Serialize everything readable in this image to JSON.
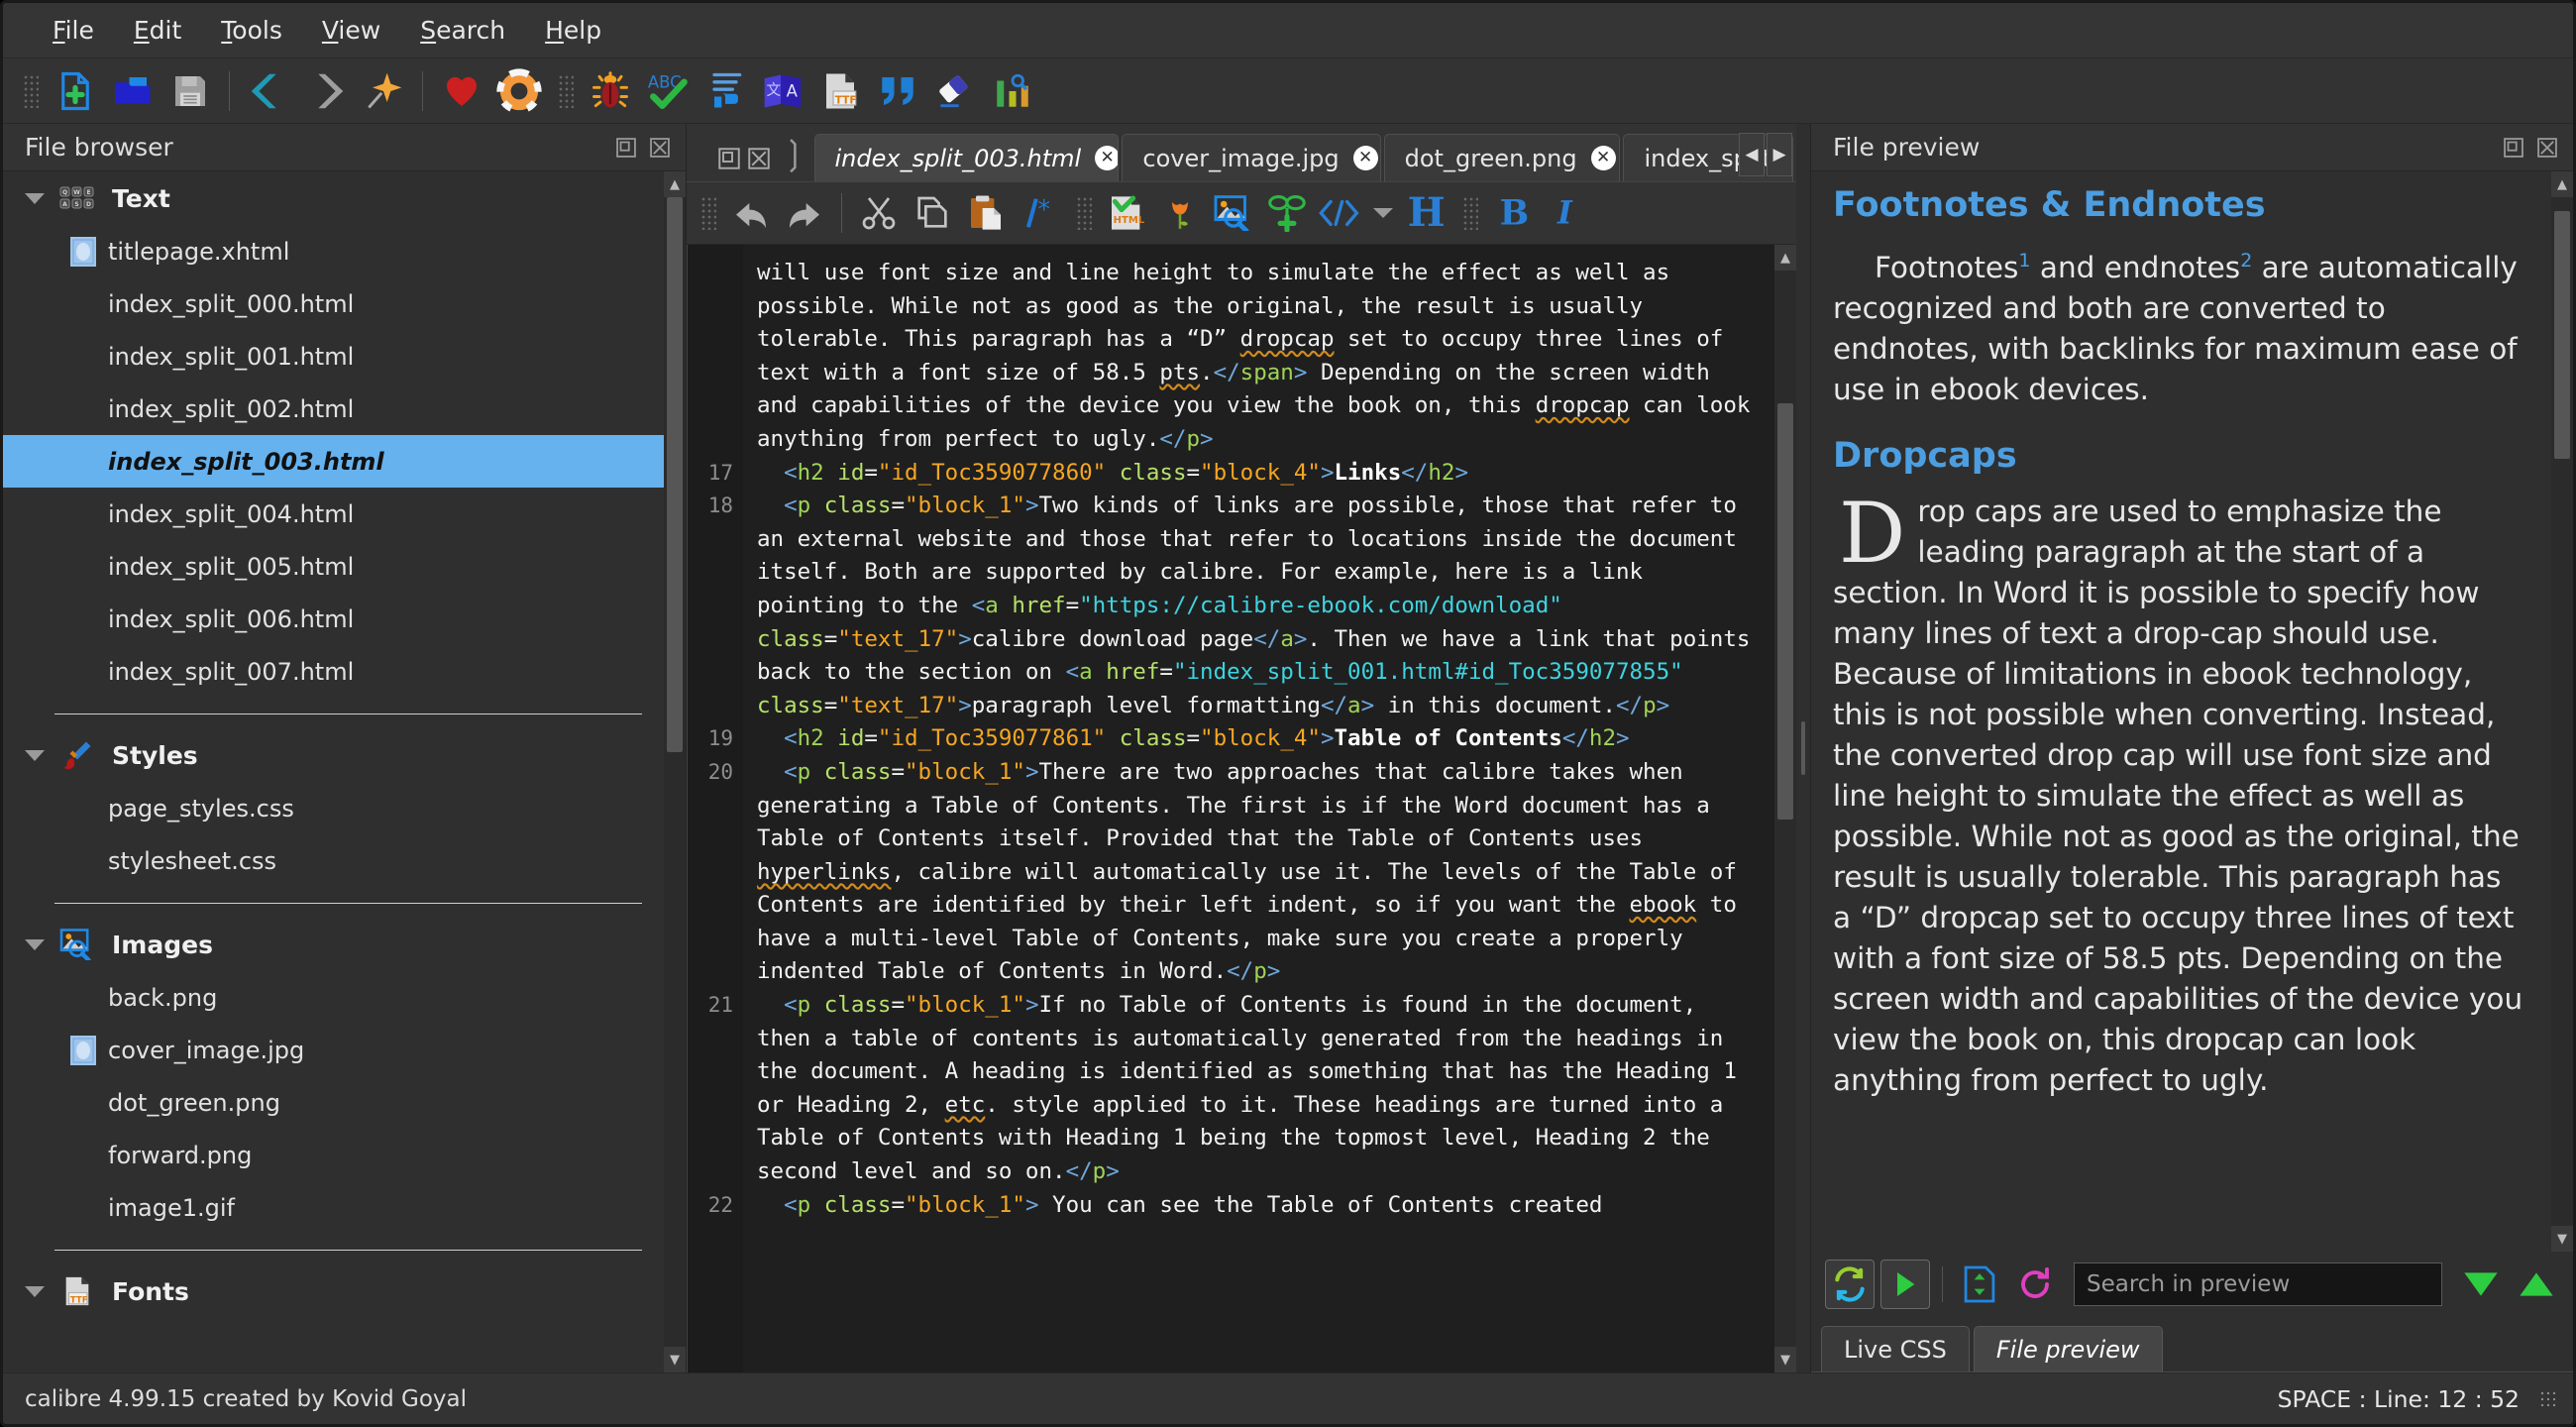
{
  "window": {
    "title": "calibre editor"
  },
  "menubar": {
    "items": [
      {
        "label": "File",
        "accel": "F"
      },
      {
        "label": "Edit",
        "accel": "E"
      },
      {
        "label": "Tools",
        "accel": "T"
      },
      {
        "label": "View",
        "accel": "V"
      },
      {
        "label": "Search",
        "accel": "S"
      },
      {
        "label": "Help",
        "accel": "H"
      }
    ]
  },
  "main_toolbar": {
    "buttons": [
      {
        "name": "new-file-icon",
        "title": "New file"
      },
      {
        "name": "open-folder-icon",
        "title": "Open book"
      },
      {
        "name": "save-icon",
        "title": "Save"
      },
      {
        "name": "back-arrow-icon",
        "title": "Back"
      },
      {
        "name": "forward-arrow-icon",
        "title": "Forward"
      },
      {
        "name": "pin-star-icon",
        "title": "Mark selected text"
      },
      {
        "name": "heart-icon",
        "title": "Donate"
      },
      {
        "name": "lifebuoy-icon",
        "title": "Help"
      },
      {
        "name": "bug-icon",
        "title": "Check book"
      },
      {
        "name": "spellcheck-icon",
        "title": "Check spelling"
      },
      {
        "name": "indent-icon",
        "title": "Smarten punctuation"
      },
      {
        "name": "translate-icon",
        "title": "Manage snippets"
      },
      {
        "name": "ttf-font-icon",
        "title": "Manage fonts"
      },
      {
        "name": "quote-icon",
        "title": "Smart quotes"
      },
      {
        "name": "eraser-icon",
        "title": "Remove unused CSS"
      },
      {
        "name": "bar-chart-icon",
        "title": "Reports"
      }
    ]
  },
  "file_browser": {
    "title": "File browser",
    "header_buttons": [
      "undock-icon",
      "close-icon"
    ],
    "groups": [
      {
        "name": "Text",
        "icon": "keyboard-icon",
        "expanded": true,
        "files": [
          {
            "label": "titlepage.xhtml",
            "icon": "cover-thumb-icon",
            "selected": false
          },
          {
            "label": "index_split_000.html",
            "icon": "",
            "selected": false
          },
          {
            "label": "index_split_001.html",
            "icon": "",
            "selected": false
          },
          {
            "label": "index_split_002.html",
            "icon": "",
            "selected": false
          },
          {
            "label": "index_split_003.html",
            "icon": "",
            "selected": true
          },
          {
            "label": "index_split_004.html",
            "icon": "",
            "selected": false
          },
          {
            "label": "index_split_005.html",
            "icon": "",
            "selected": false
          },
          {
            "label": "index_split_006.html",
            "icon": "",
            "selected": false
          },
          {
            "label": "index_split_007.html",
            "icon": "",
            "selected": false
          }
        ]
      },
      {
        "name": "Styles",
        "icon": "paintbrush-icon",
        "expanded": true,
        "files": [
          {
            "label": "page_styles.css",
            "icon": "",
            "selected": false
          },
          {
            "label": "stylesheet.css",
            "icon": "",
            "selected": false
          }
        ]
      },
      {
        "name": "Images",
        "icon": "image-search-icon",
        "expanded": true,
        "files": [
          {
            "label": "back.png",
            "icon": "",
            "selected": false
          },
          {
            "label": "cover_image.jpg",
            "icon": "cover-thumb-icon",
            "selected": false
          },
          {
            "label": "dot_green.png",
            "icon": "",
            "selected": false
          },
          {
            "label": "forward.png",
            "icon": "",
            "selected": false
          },
          {
            "label": "image1.gif",
            "icon": "",
            "selected": false
          }
        ]
      },
      {
        "name": "Fonts",
        "icon": "ttf-font-icon",
        "expanded": true,
        "files": []
      }
    ]
  },
  "editor": {
    "tab_controls": [
      "undock-icon",
      "close-icon"
    ],
    "tabs": [
      {
        "label": "index_split_003.html",
        "active": true,
        "closable": true
      },
      {
        "label": "cover_image.jpg",
        "active": false,
        "closable": true
      },
      {
        "label": "dot_green.png",
        "active": false,
        "closable": true
      },
      {
        "label": "index_split_",
        "active": false,
        "closable": false
      }
    ],
    "tab_nav": [
      "scroll-left-icon",
      "scroll-right-icon"
    ],
    "toolbar_buttons": [
      {
        "name": "undo-icon",
        "title": "Undo"
      },
      {
        "name": "redo-icon",
        "title": "Redo"
      },
      {
        "name": "cut-icon",
        "title": "Cut"
      },
      {
        "name": "copy-icon",
        "title": "Copy"
      },
      {
        "name": "paste-icon",
        "title": "Paste"
      },
      {
        "name": "comment-icon",
        "title": "Insert comment"
      },
      {
        "name": "html-check-icon",
        "title": "Check HTML"
      },
      {
        "name": "tulip-icon",
        "title": "Beautify"
      },
      {
        "name": "insert-image-icon",
        "title": "Insert image"
      },
      {
        "name": "insert-link-icon",
        "title": "Insert link"
      },
      {
        "name": "code-tag-icon",
        "title": "Insert tag"
      },
      {
        "name": "heading-icon",
        "title": "Heading"
      },
      {
        "name": "bold-icon",
        "title": "Bold"
      },
      {
        "name": "italic-icon",
        "title": "Italic"
      }
    ],
    "lines": [
      {
        "num": "",
        "segments": [
          {
            "t": "will use font size and line height to simulate the effect as well as possible. While not as good as the original, the result is usually tolerable. This paragraph has a “D” ",
            "c": ""
          },
          {
            "t": "dropcap",
            "c": "sp"
          },
          {
            "t": " set to occupy three lines of text with a font size of 58.5 ",
            "c": ""
          },
          {
            "t": "pts",
            "c": "sp"
          },
          {
            "t": ".",
            "c": ""
          },
          {
            "t": "</",
            "c": "br"
          },
          {
            "t": "span",
            "c": "tg"
          },
          {
            "t": ">",
            "c": "br"
          },
          {
            "t": " Depending on the screen width and capabilities of the device you view the book on, this ",
            "c": ""
          },
          {
            "t": "dropcap",
            "c": "sp"
          },
          {
            "t": " can look anything from perfect to ugly.",
            "c": ""
          },
          {
            "t": "</",
            "c": "br"
          },
          {
            "t": "p",
            "c": "tg"
          },
          {
            "t": ">",
            "c": "br"
          }
        ]
      },
      {
        "num": "17",
        "segments": [
          {
            "t": "  ",
            "c": ""
          },
          {
            "t": "<",
            "c": "br"
          },
          {
            "t": "h2",
            "c": "tg"
          },
          {
            "t": " ",
            "c": ""
          },
          {
            "t": "id",
            "c": "at"
          },
          {
            "t": "=",
            "c": ""
          },
          {
            "t": "\"id_Toc359077860\"",
            "c": "vl"
          },
          {
            "t": " ",
            "c": ""
          },
          {
            "t": "class",
            "c": "at"
          },
          {
            "t": "=",
            "c": ""
          },
          {
            "t": "\"block_4\"",
            "c": "vl"
          },
          {
            "t": ">",
            "c": "br"
          },
          {
            "t": "Links",
            "c": "bd"
          },
          {
            "t": "</",
            "c": "br"
          },
          {
            "t": "h2",
            "c": "tg"
          },
          {
            "t": ">",
            "c": "br"
          }
        ]
      },
      {
        "num": "18",
        "segments": [
          {
            "t": "  ",
            "c": ""
          },
          {
            "t": "<",
            "c": "br"
          },
          {
            "t": "p",
            "c": "tg"
          },
          {
            "t": " ",
            "c": ""
          },
          {
            "t": "class",
            "c": "at"
          },
          {
            "t": "=",
            "c": ""
          },
          {
            "t": "\"block_1\"",
            "c": "vl"
          },
          {
            "t": ">",
            "c": "br"
          },
          {
            "t": "Two kinds of links are possible, those that refer to an external website and those that refer to locations inside the document itself. Both are supported by calibre. For example, here is a link pointing to the ",
            "c": ""
          },
          {
            "t": "<",
            "c": "br"
          },
          {
            "t": "a",
            "c": "tg"
          },
          {
            "t": " ",
            "c": ""
          },
          {
            "t": "href",
            "c": "at"
          },
          {
            "t": "=",
            "c": ""
          },
          {
            "t": "\"https://calibre-ebook.com/download\"",
            "c": "lk"
          },
          {
            "t": " ",
            "c": ""
          },
          {
            "t": "class",
            "c": "at"
          },
          {
            "t": "=",
            "c": ""
          },
          {
            "t": "\"text_17\"",
            "c": "vl"
          },
          {
            "t": ">",
            "c": "br"
          },
          {
            "t": "calibre download page",
            "c": ""
          },
          {
            "t": "</",
            "c": "br"
          },
          {
            "t": "a",
            "c": "tg"
          },
          {
            "t": ">",
            "c": "br"
          },
          {
            "t": ". Then we have a link that points back to the section on ",
            "c": ""
          },
          {
            "t": "<",
            "c": "br"
          },
          {
            "t": "a",
            "c": "tg"
          },
          {
            "t": " ",
            "c": ""
          },
          {
            "t": "href",
            "c": "at"
          },
          {
            "t": "=",
            "c": ""
          },
          {
            "t": "\"index_split_001.html#id_Toc359077855\"",
            "c": "lk"
          },
          {
            "t": " ",
            "c": ""
          },
          {
            "t": "class",
            "c": "at"
          },
          {
            "t": "=",
            "c": ""
          },
          {
            "t": "\"text_17\"",
            "c": "vl"
          },
          {
            "t": ">",
            "c": "br"
          },
          {
            "t": "paragraph level formatting",
            "c": ""
          },
          {
            "t": "</",
            "c": "br"
          },
          {
            "t": "a",
            "c": "tg"
          },
          {
            "t": ">",
            "c": "br"
          },
          {
            "t": " in this document.",
            "c": ""
          },
          {
            "t": "</",
            "c": "br"
          },
          {
            "t": "p",
            "c": "tg"
          },
          {
            "t": ">",
            "c": "br"
          }
        ]
      },
      {
        "num": "19",
        "segments": [
          {
            "t": "  ",
            "c": ""
          },
          {
            "t": "<",
            "c": "br"
          },
          {
            "t": "h2",
            "c": "tg"
          },
          {
            "t": " ",
            "c": ""
          },
          {
            "t": "id",
            "c": "at"
          },
          {
            "t": "=",
            "c": ""
          },
          {
            "t": "\"id_Toc359077861\"",
            "c": "vl"
          },
          {
            "t": " ",
            "c": ""
          },
          {
            "t": "class",
            "c": "at"
          },
          {
            "t": "=",
            "c": ""
          },
          {
            "t": "\"block_4\"",
            "c": "vl"
          },
          {
            "t": ">",
            "c": "br"
          },
          {
            "t": "Table of Contents",
            "c": "bd"
          },
          {
            "t": "</",
            "c": "br"
          },
          {
            "t": "h2",
            "c": "tg"
          },
          {
            "t": ">",
            "c": "br"
          }
        ]
      },
      {
        "num": "20",
        "segments": [
          {
            "t": "  ",
            "c": ""
          },
          {
            "t": "<",
            "c": "br"
          },
          {
            "t": "p",
            "c": "tg"
          },
          {
            "t": " ",
            "c": ""
          },
          {
            "t": "class",
            "c": "at"
          },
          {
            "t": "=",
            "c": ""
          },
          {
            "t": "\"block_1\"",
            "c": "vl"
          },
          {
            "t": ">",
            "c": "br"
          },
          {
            "t": "There are two approaches that calibre takes when generating a Table of Contents. The first is if the Word document has a Table of Contents itself. Provided that the Table of Contents uses ",
            "c": ""
          },
          {
            "t": "hyperlinks",
            "c": "sp"
          },
          {
            "t": ", calibre will automatically use it. The levels of the Table of Contents are identified by their left indent, so if you want the ",
            "c": ""
          },
          {
            "t": "ebook",
            "c": "sp"
          },
          {
            "t": " to have a multi-level Table of Contents, make sure you create a properly indented Table of Contents in Word.",
            "c": ""
          },
          {
            "t": "</",
            "c": "br"
          },
          {
            "t": "p",
            "c": "tg"
          },
          {
            "t": ">",
            "c": "br"
          }
        ]
      },
      {
        "num": "21",
        "segments": [
          {
            "t": "  ",
            "c": ""
          },
          {
            "t": "<",
            "c": "br"
          },
          {
            "t": "p",
            "c": "tg"
          },
          {
            "t": " ",
            "c": ""
          },
          {
            "t": "class",
            "c": "at"
          },
          {
            "t": "=",
            "c": ""
          },
          {
            "t": "\"block_1\"",
            "c": "vl"
          },
          {
            "t": ">",
            "c": "br"
          },
          {
            "t": "If no Table of Contents is found in the document, then a table of contents is automatically generated from the headings in the document. A heading is identified as something that has the Heading 1 or Heading 2, ",
            "c": ""
          },
          {
            "t": "etc",
            "c": "sp"
          },
          {
            "t": ". style applied to it. These headings are turned into a Table of Contents with Heading 1 being the topmost level, Heading 2 the second level and so on.",
            "c": ""
          },
          {
            "t": "</",
            "c": "br"
          },
          {
            "t": "p",
            "c": "tg"
          },
          {
            "t": ">",
            "c": "br"
          }
        ]
      },
      {
        "num": "22",
        "segments": [
          {
            "t": "  ",
            "c": ""
          },
          {
            "t": "<",
            "c": "br"
          },
          {
            "t": "p",
            "c": "tg"
          },
          {
            "t": " ",
            "c": ""
          },
          {
            "t": "class",
            "c": "at"
          },
          {
            "t": "=",
            "c": ""
          },
          {
            "t": "\"block_1\"",
            "c": "vl"
          },
          {
            "t": ">",
            "c": "br"
          },
          {
            "t": " You can see the Table of Contents created",
            "c": ""
          }
        ]
      }
    ]
  },
  "preview": {
    "title": "File preview",
    "header_buttons": [
      "undock-icon",
      "close-icon"
    ],
    "heading1": "Footnotes & Endnotes",
    "para1_a": "Footnotes",
    "para1_sup1": "1",
    "para1_b": " and endnotes",
    "para1_sup2": "2",
    "para1_c": " are automatically recognized and both are converted to endnotes, with backlinks for maximum ease of use in ebook devices.",
    "heading2": "Dropcaps",
    "dropcap_letter": "D",
    "para2": "rop caps are used to emphasize the leading paragraph at the start of a section. In Word it is possible to specify how many lines of text a drop-cap should use. Because of limitations in ebook technology, this is not possible when converting.  Instead, the converted drop cap will use font size and line height to simulate the effect as well as possible. While not as good as the original, the result is usually tolerable. This paragraph has a “D” dropcap set to occupy three lines of text with a font size of 58.5 pts. Depending on the screen width and capabilities of the device you view the book on, this dropcap can look anything from perfect to ugly.",
    "toolbar": {
      "buttons": [
        {
          "name": "auto-reload-icon",
          "title": "Auto reload preview"
        },
        {
          "name": "play-icon",
          "title": "Refresh preview"
        },
        {
          "name": "sync-position-icon",
          "title": "Sync preview position"
        },
        {
          "name": "refresh-icon",
          "title": "Reload preview"
        },
        {
          "name": "find-prev-icon",
          "title": "Find previous"
        },
        {
          "name": "find-next-icon",
          "title": "Find next"
        }
      ],
      "search_placeholder": "Search in preview",
      "search_value": ""
    },
    "tabs": [
      {
        "label": "Live CSS",
        "active": false
      },
      {
        "label": "File preview",
        "active": true
      }
    ]
  },
  "statusbar": {
    "left": "calibre 4.99.15 created by Kovid Goyal",
    "right": "SPACE : Line: 12 : 52"
  },
  "colors": {
    "accent_blue": "#4c9ee0",
    "selection_blue": "#66b2ee",
    "tag_green": "#9fd356",
    "value_orange": "#f5a623",
    "link_cyan": "#3fd4e0",
    "bracket_blue": "#6fa8dc",
    "spell_underline": "#d08a1e",
    "bg_dark": "#2f2f2f",
    "editor_bg": "#1f1f1f"
  }
}
